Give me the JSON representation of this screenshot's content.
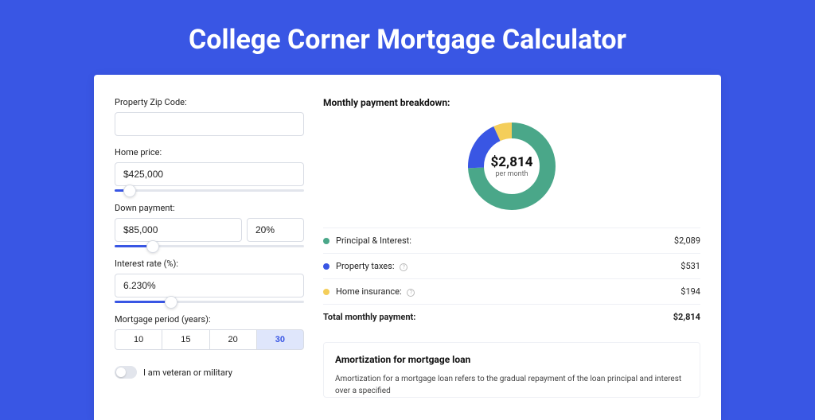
{
  "page_title": "College Corner Mortgage Calculator",
  "form": {
    "zip_label": "Property Zip Code:",
    "zip_value": "",
    "home_price_label": "Home price:",
    "home_price_value": "$425,000",
    "home_price_slider_pct": 8,
    "down_payment_label": "Down payment:",
    "down_payment_value": "$85,000",
    "down_payment_pct_value": "20%",
    "down_payment_slider_pct": 20,
    "interest_label": "Interest rate (%):",
    "interest_value": "6.230%",
    "interest_slider_pct": 30,
    "period_label": "Mortgage period (years):",
    "period_options": [
      "10",
      "15",
      "20",
      "30"
    ],
    "period_selected": "30",
    "veteran_label": "I am veteran or military",
    "veteran_on": false
  },
  "breakdown": {
    "title": "Monthly payment breakdown:",
    "donut_amount": "$2,814",
    "donut_sub": "per month",
    "rows": [
      {
        "label": "Principal & Interest:",
        "value": "$2,089",
        "color": "#4aa789",
        "info": false
      },
      {
        "label": "Property taxes:",
        "value": "$531",
        "color": "#3956e4",
        "info": true
      },
      {
        "label": "Home insurance:",
        "value": "$194",
        "color": "#f4ce5a",
        "info": true
      }
    ],
    "total_label": "Total monthly payment:",
    "total_value": "$2,814"
  },
  "chart_data": {
    "type": "pie",
    "title": "Monthly payment breakdown",
    "series": [
      {
        "name": "Principal & Interest",
        "value": 2089,
        "color": "#4aa789"
      },
      {
        "name": "Property taxes",
        "value": 531,
        "color": "#3956e4"
      },
      {
        "name": "Home insurance",
        "value": 194,
        "color": "#f4ce5a"
      }
    ],
    "total": 2814,
    "unit": "$ per month"
  },
  "amort": {
    "title": "Amortization for mortgage loan",
    "body": "Amortization for a mortgage loan refers to the gradual repayment of the loan principal and interest over a specified"
  }
}
